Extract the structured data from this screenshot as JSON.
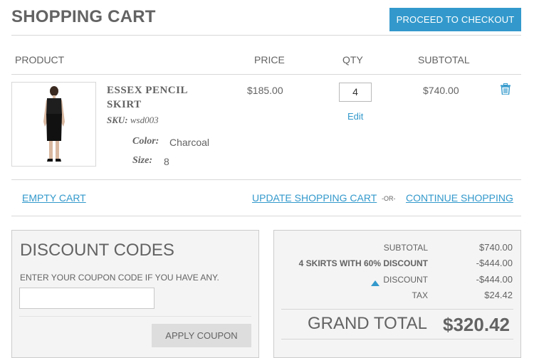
{
  "page": {
    "title": "SHOPPING CART",
    "checkout_label": "PROCEED TO CHECKOUT"
  },
  "columns": {
    "product": "PRODUCT",
    "price": "PRICE",
    "qty": "QTY",
    "subtotal": "SUBTOTAL"
  },
  "item": {
    "name_line1": "ESSEX PENCIL",
    "name_line2": "SKIRT",
    "sku_label": "SKU:",
    "sku_value": "wsd003",
    "color_label": "Color:",
    "color_value": "Charcoal",
    "size_label": "Size:",
    "size_value": "8",
    "price": "$185.00",
    "qty": "4",
    "edit_label": "Edit",
    "subtotal": "$740.00",
    "remove_icon": "trash-icon"
  },
  "actions": {
    "empty_cart": "EMPTY CART",
    "update_cart": "UPDATE SHOPPING CART",
    "or_text": "-OR-",
    "continue_shopping": "CONTINUE SHOPPING"
  },
  "discount": {
    "title": "DISCOUNT CODES",
    "help": "ENTER YOUR COUPON CODE IF YOU HAVE ANY.",
    "input_value": "",
    "apply_label": "APPLY COUPON"
  },
  "totals": {
    "rows": [
      {
        "label": "SUBTOTAL",
        "value": "$740.00",
        "bold": false
      },
      {
        "label": "4 SKIRTS WITH 60% DISCOUNT",
        "value": "-$444.00",
        "bold": true
      },
      {
        "label": "DISCOUNT",
        "value": "-$444.00",
        "bold": false,
        "icon": "triangle-up-icon"
      },
      {
        "label": "TAX",
        "value": "$24.42",
        "bold": false
      }
    ],
    "grand_label": "GRAND TOTAL",
    "grand_value": "$320.42"
  },
  "colors": {
    "accent": "#3399cc",
    "text": "#636363",
    "panel_bg": "#f4f4f4"
  }
}
